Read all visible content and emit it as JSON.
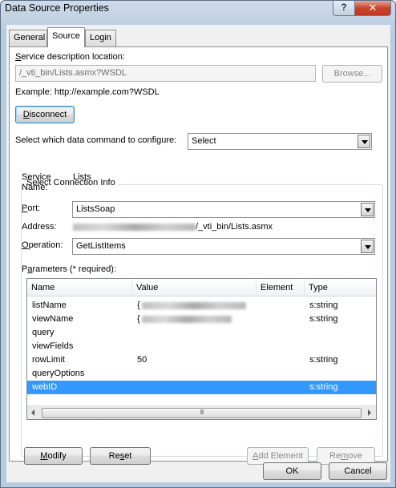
{
  "window": {
    "title": "Data Source Properties",
    "help_glyph": "?",
    "close_glyph": "✕"
  },
  "tabs": [
    {
      "label": "General"
    },
    {
      "label": "Source"
    },
    {
      "label": "Login"
    }
  ],
  "source": {
    "service_description_label": "Service description location:",
    "service_url": "/_vti_bin/Lists.asmx?WSDL",
    "browse_label": "Browse...",
    "example_text": "Example: http://example.com?WSDL",
    "disconnect_label": "Disconnect",
    "command_label": "Select which data command to configure:",
    "command_value": "Select"
  },
  "connection": {
    "group_title": "Select Connection Info",
    "service_name_label_1": "Service",
    "service_name_label_2": "Name:",
    "service_name_value": "Lists",
    "port_label": "Port:",
    "port_value": "ListsSoap",
    "address_label": "Address:",
    "address_suffix": "/_vti_bin/Lists.asmx",
    "operation_label": "Operation:",
    "operation_value": "GetListItems"
  },
  "parameters": {
    "label": "Parameters (* required):",
    "columns": [
      "Name",
      "Value",
      "Element",
      "Type"
    ],
    "rows": [
      {
        "name": "listName",
        "value": "{",
        "element": "",
        "type": "s:string",
        "redacted": true,
        "selected": false
      },
      {
        "name": "viewName",
        "value": "{",
        "element": "",
        "type": "s:string",
        "redacted": true,
        "selected": false
      },
      {
        "name": "query",
        "value": "",
        "element": "",
        "type": "",
        "redacted": false,
        "selected": false
      },
      {
        "name": "viewFields",
        "value": "",
        "element": "",
        "type": "",
        "redacted": false,
        "selected": false
      },
      {
        "name": "rowLimit",
        "value": "50",
        "element": "",
        "type": "s:string",
        "redacted": false,
        "selected": false
      },
      {
        "name": "queryOptions",
        "value": "",
        "element": "",
        "type": "",
        "redacted": false,
        "selected": false
      },
      {
        "name": "webID",
        "value": "",
        "element": "",
        "type": "s:string",
        "redacted": false,
        "selected": true
      }
    ]
  },
  "buttons": {
    "modify": "Modify",
    "reset": "Reset",
    "add_element": "Add Element",
    "remove": "Remove",
    "ok": "OK",
    "cancel": "Cancel"
  }
}
